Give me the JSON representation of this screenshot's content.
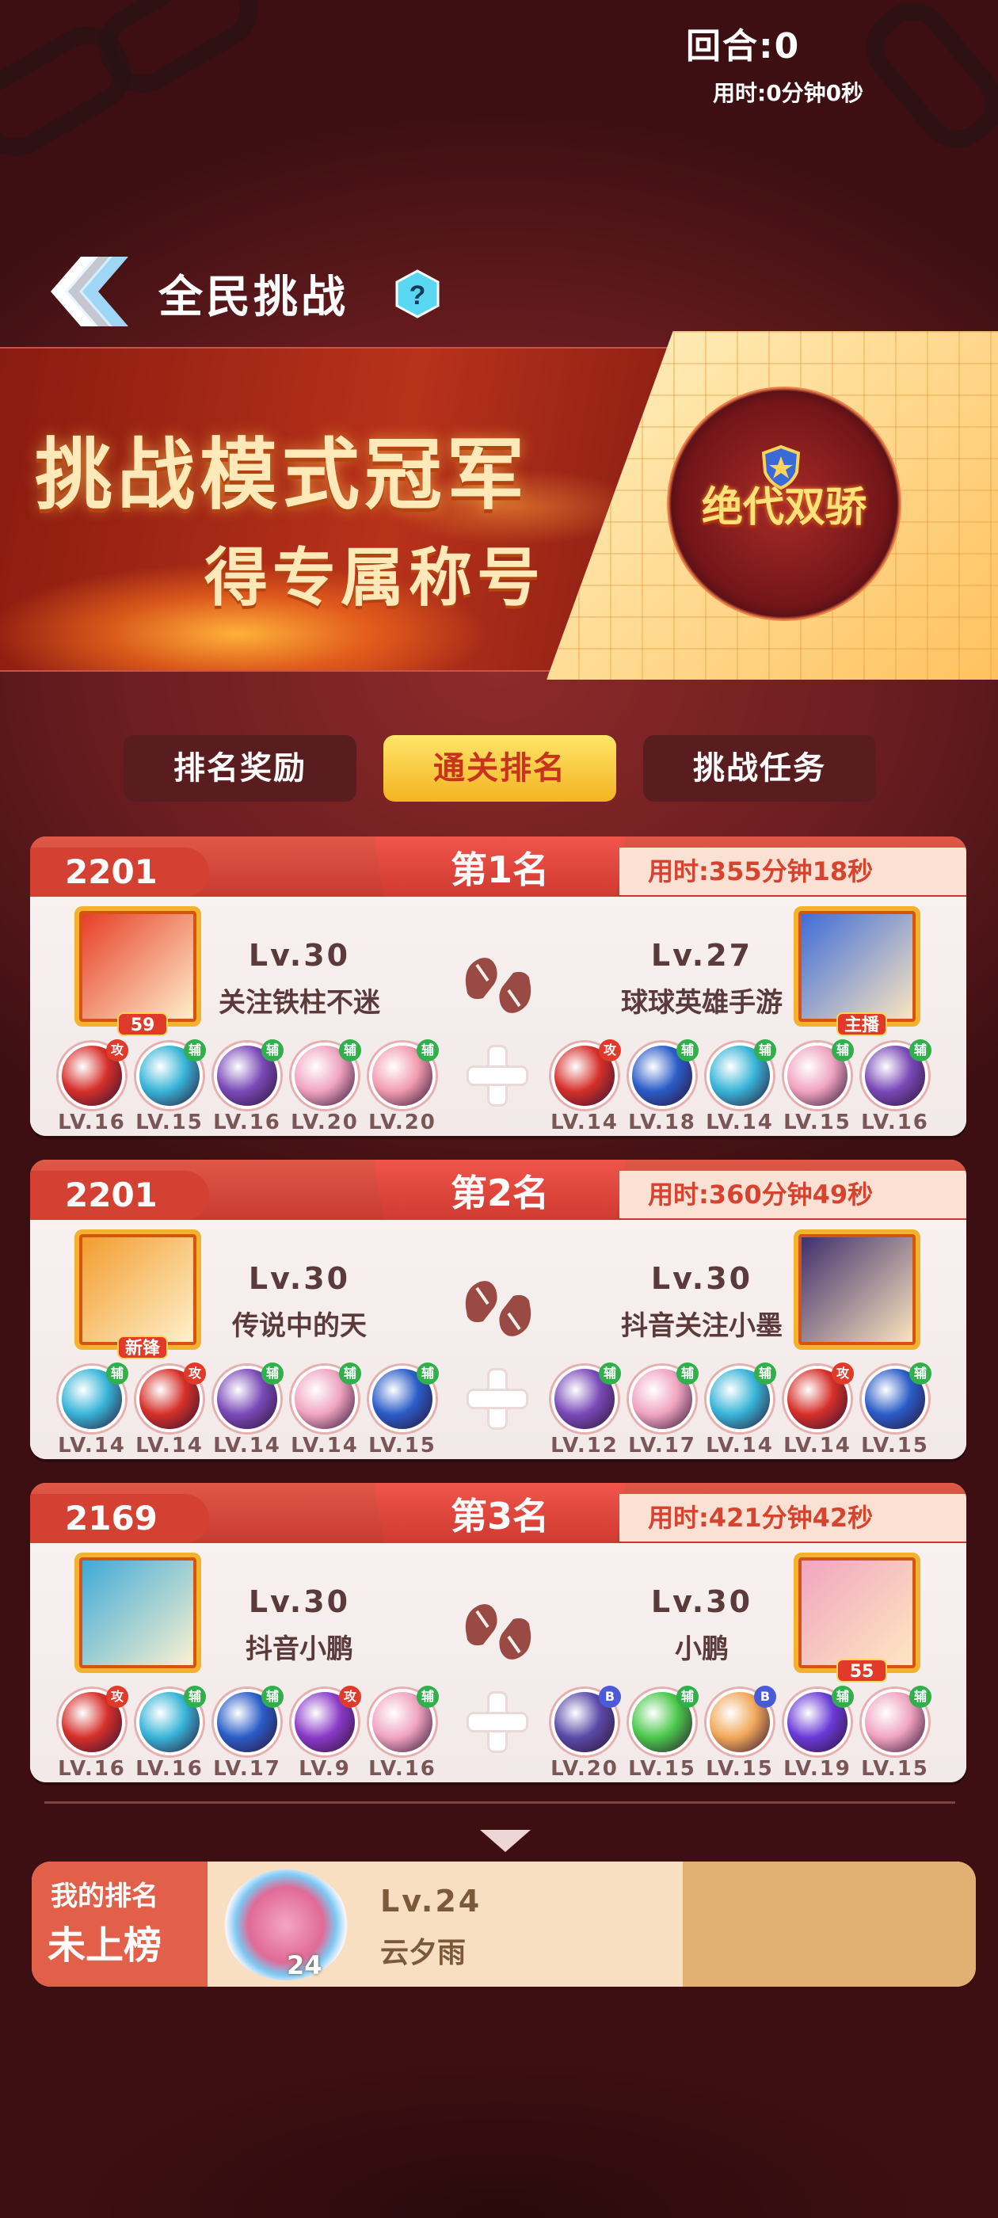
{
  "header": {
    "title": "全民挑战",
    "help_icon": "?"
  },
  "banner": {
    "line1": "挑战模式冠军",
    "line2": "得专属称号",
    "emblem_title": "绝代双骄"
  },
  "tabs": [
    {
      "label": "排名奖励",
      "active": false
    },
    {
      "label": "通关排名",
      "active": true
    },
    {
      "label": "挑战任务",
      "active": false
    }
  ],
  "rankings": [
    {
      "score": "2201",
      "rank": "第1名",
      "time": "用时:355分钟18秒",
      "left": {
        "lv": "Lv.30",
        "name": "关注铁柱不迷",
        "badge": "59",
        "orbs": [
          {
            "lv": "LV.16",
            "tag": "攻",
            "color": "#d6302a"
          },
          {
            "lv": "LV.15",
            "tag": "辅",
            "color": "#38b4d8"
          },
          {
            "lv": "LV.16",
            "tag": "辅",
            "color": "#7a4ab8"
          },
          {
            "lv": "LV.20",
            "tag": "辅",
            "color": "#f0a4c0"
          },
          {
            "lv": "LV.20",
            "tag": "辅",
            "color": "#f29cb0"
          }
        ]
      },
      "right": {
        "lv": "Lv.27",
        "name": "球球英雄手游",
        "badge": "主播",
        "orbs": [
          {
            "lv": "LV.14",
            "tag": "攻",
            "color": "#d6302a"
          },
          {
            "lv": "LV.18",
            "tag": "辅",
            "color": "#2a5cc8"
          },
          {
            "lv": "LV.14",
            "tag": "辅",
            "color": "#38b4d8"
          },
          {
            "lv": "LV.15",
            "tag": "辅",
            "color": "#f0a4c0"
          },
          {
            "lv": "LV.16",
            "tag": "辅",
            "color": "#7a4ab8"
          }
        ]
      }
    },
    {
      "score": "2201",
      "rank": "第2名",
      "time": "用时:360分钟49秒",
      "left": {
        "lv": "Lv.30",
        "name": "传说中的天",
        "badge": "新锋",
        "orbs": [
          {
            "lv": "LV.14",
            "tag": "辅",
            "color": "#38b4d8"
          },
          {
            "lv": "LV.14",
            "tag": "攻",
            "color": "#d6302a"
          },
          {
            "lv": "LV.14",
            "tag": "辅",
            "color": "#7a4ab8"
          },
          {
            "lv": "LV.14",
            "tag": "辅",
            "color": "#f0a4c0"
          },
          {
            "lv": "LV.15",
            "tag": "辅",
            "color": "#2a5cc8"
          }
        ]
      },
      "right": {
        "lv": "Lv.30",
        "name": "抖音关注小墨",
        "badge": "",
        "orbs": [
          {
            "lv": "LV.12",
            "tag": "辅",
            "color": "#7a4ab8"
          },
          {
            "lv": "LV.17",
            "tag": "辅",
            "color": "#f0a4c0"
          },
          {
            "lv": "LV.14",
            "tag": "辅",
            "color": "#38b4d8"
          },
          {
            "lv": "LV.14",
            "tag": "攻",
            "color": "#d6302a"
          },
          {
            "lv": "LV.15",
            "tag": "辅",
            "color": "#2a5cc8"
          }
        ]
      }
    },
    {
      "score": "2169",
      "rank": "第3名",
      "time": "用时:421分钟42秒",
      "left": {
        "lv": "Lv.30",
        "name": "抖音小鹏",
        "badge": "",
        "orbs": [
          {
            "lv": "LV.16",
            "tag": "攻",
            "color": "#d6302a"
          },
          {
            "lv": "LV.16",
            "tag": "辅",
            "color": "#38b4d8"
          },
          {
            "lv": "LV.17",
            "tag": "辅",
            "color": "#2a5cc8"
          },
          {
            "lv": "LV.9",
            "tag": "攻",
            "color": "#8a3ac8"
          },
          {
            "lv": "LV.16",
            "tag": "辅",
            "color": "#f0a4c0"
          }
        ]
      },
      "right": {
        "lv": "Lv.30",
        "name": "小鹏",
        "badge": "55",
        "orbs": [
          {
            "lv": "LV.20",
            "tag": "B",
            "color": "#5a4aa8"
          },
          {
            "lv": "LV.15",
            "tag": "辅",
            "color": "#4ac84a"
          },
          {
            "lv": "LV.15",
            "tag": "B",
            "color": "#f2a85a"
          },
          {
            "lv": "LV.19",
            "tag": "辅",
            "color": "#6a3ad8"
          },
          {
            "lv": "LV.15",
            "tag": "辅",
            "color": "#f0a4c0"
          }
        ]
      }
    }
  ],
  "my_rank": {
    "label": "我的排名",
    "value": "未上榜",
    "level_badge": "24",
    "lv": "Lv.24",
    "name": "云夕雨",
    "round": "回合:0",
    "time": "用时:0分钟0秒"
  },
  "colors": {
    "accent": "#c73a30",
    "tab_active": "#f4b321",
    "bg": "#6a1d20"
  }
}
